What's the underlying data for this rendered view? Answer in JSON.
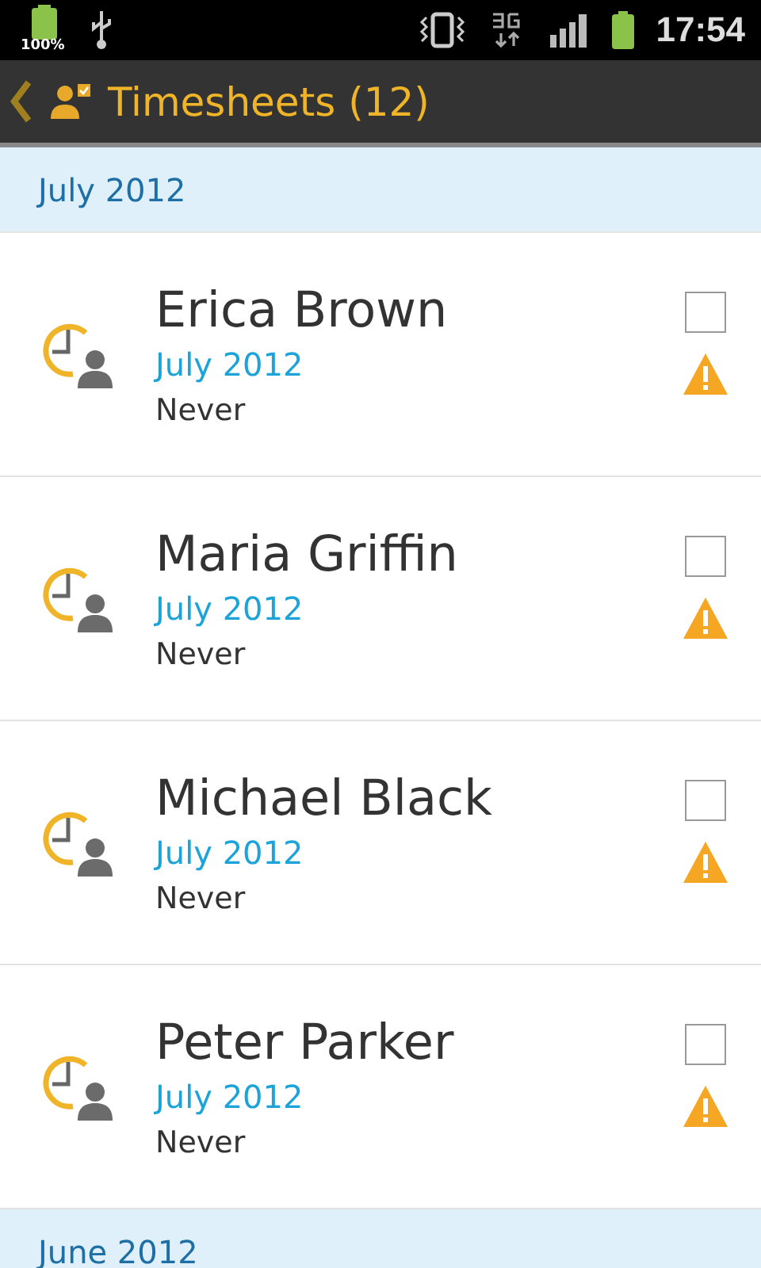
{
  "status_bar": {
    "battery_label": "100%",
    "time": "17:54"
  },
  "action_bar": {
    "title": "Timesheets (12)"
  },
  "sections": [
    {
      "header": "July 2012",
      "items": [
        {
          "name": "Erica Brown",
          "period": "July 2012",
          "last": "Never",
          "checked": false,
          "warning": true
        },
        {
          "name": "Maria Griffin",
          "period": "July 2012",
          "last": "Never",
          "checked": false,
          "warning": true
        },
        {
          "name": "Michael Black",
          "period": "July 2012",
          "last": "Never",
          "checked": false,
          "warning": true
        },
        {
          "name": "Peter Parker",
          "period": "July 2012",
          "last": "Never",
          "checked": false,
          "warning": true
        }
      ]
    },
    {
      "header": "June 2012"
    }
  ]
}
